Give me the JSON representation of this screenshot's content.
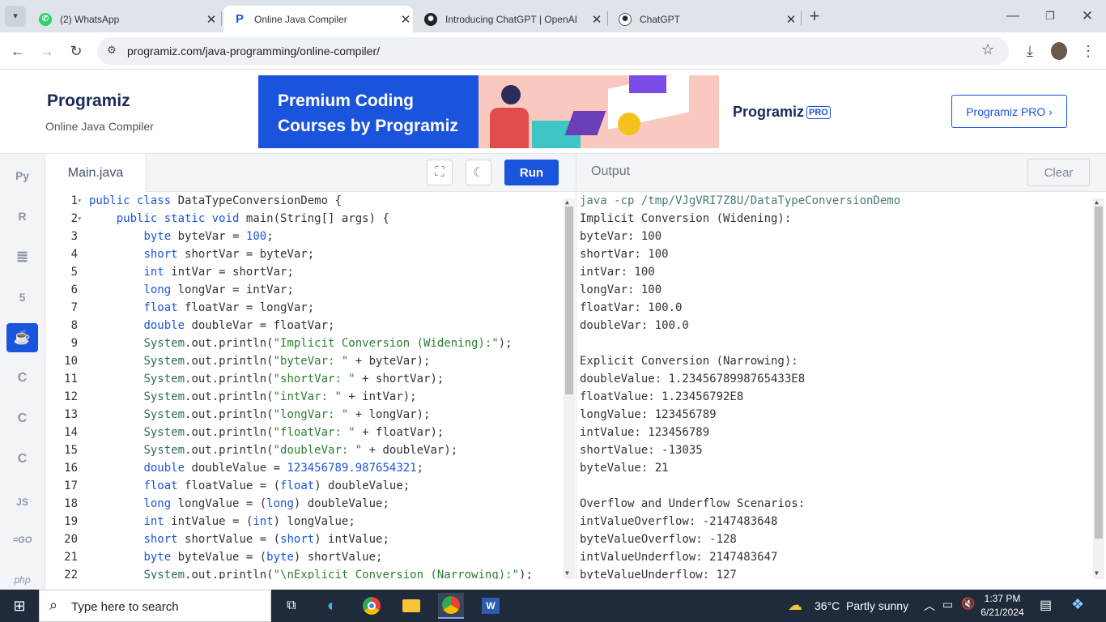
{
  "browser": {
    "tabs": [
      {
        "title": "(2) WhatsApp",
        "favicon": "whatsapp-icon"
      },
      {
        "title": "Online Java Compiler",
        "favicon": "programiz-icon",
        "active": true
      },
      {
        "title": "Introducing ChatGPT | OpenAI",
        "favicon": "openai-icon"
      },
      {
        "title": "ChatGPT",
        "favicon": "openai-icon"
      }
    ],
    "new_tab_symbol": "+",
    "url": "programiz.com/java-programming/online-compiler/"
  },
  "site": {
    "logo_text": "Programiz",
    "subtitle": "Online Java Compiler",
    "ad": {
      "headline_line1": "Premium Coding",
      "headline_line2": "Courses by Programiz",
      "brand": "Programiz",
      "brand_badge": "PRO"
    },
    "pro_button": "Programiz PRO ›"
  },
  "sidebar": {
    "items": [
      {
        "name": "python",
        "glyph": "Py"
      },
      {
        "name": "r",
        "glyph": "R"
      },
      {
        "name": "sql",
        "glyph": "≣"
      },
      {
        "name": "html",
        "glyph": "5"
      },
      {
        "name": "java",
        "glyph": "☕",
        "active": true
      },
      {
        "name": "c",
        "glyph": "C"
      },
      {
        "name": "cpp",
        "glyph": "C"
      },
      {
        "name": "csharp",
        "glyph": "C"
      },
      {
        "name": "js",
        "glyph": "JS"
      },
      {
        "name": "go",
        "glyph": "=GO"
      },
      {
        "name": "php",
        "glyph": "php"
      }
    ]
  },
  "editor": {
    "filename": "Main.java",
    "run_label": "Run",
    "lines": [
      {
        "n": "1",
        "fold": true,
        "tokens": [
          [
            "kw",
            "public class "
          ],
          [
            "t",
            "DataTypeConversionDemo {"
          ]
        ]
      },
      {
        "n": "2",
        "fold": true,
        "tokens": [
          [
            "t",
            "    "
          ],
          [
            "kw",
            "public static void "
          ],
          [
            "t",
            "main(String[] args) {"
          ]
        ]
      },
      {
        "n": "3",
        "tokens": [
          [
            "t",
            "        "
          ],
          [
            "kw",
            "byte "
          ],
          [
            "t",
            "byteVar = "
          ],
          [
            "num",
            "100"
          ],
          [
            "t",
            ";"
          ]
        ]
      },
      {
        "n": "4",
        "tokens": [
          [
            "t",
            "        "
          ],
          [
            "kw",
            "short "
          ],
          [
            "t",
            "shortVar = byteVar;"
          ]
        ]
      },
      {
        "n": "5",
        "tokens": [
          [
            "t",
            "        "
          ],
          [
            "kw",
            "int "
          ],
          [
            "t",
            "intVar = shortVar;"
          ]
        ]
      },
      {
        "n": "6",
        "tokens": [
          [
            "t",
            "        "
          ],
          [
            "kw",
            "long "
          ],
          [
            "t",
            "longVar = intVar;"
          ]
        ]
      },
      {
        "n": "7",
        "tokens": [
          [
            "t",
            "        "
          ],
          [
            "kw",
            "float "
          ],
          [
            "t",
            "floatVar = longVar;"
          ]
        ]
      },
      {
        "n": "8",
        "tokens": [
          [
            "t",
            "        "
          ],
          [
            "kw",
            "double "
          ],
          [
            "t",
            "doubleVar = floatVar;"
          ]
        ]
      },
      {
        "n": "9",
        "tokens": [
          [
            "t",
            "        "
          ],
          [
            "sys",
            "System"
          ],
          [
            "t",
            ".out.println("
          ],
          [
            "str",
            "\"Implicit Conversion (Widening):\""
          ],
          [
            "t",
            ");"
          ]
        ]
      },
      {
        "n": "10",
        "tokens": [
          [
            "t",
            "        "
          ],
          [
            "sys",
            "System"
          ],
          [
            "t",
            ".out.println("
          ],
          [
            "str",
            "\"byteVar: \""
          ],
          [
            "t",
            " + byteVar);"
          ]
        ]
      },
      {
        "n": "11",
        "tokens": [
          [
            "t",
            "        "
          ],
          [
            "sys",
            "System"
          ],
          [
            "t",
            ".out.println("
          ],
          [
            "str",
            "\"shortVar: \""
          ],
          [
            "t",
            " + shortVar);"
          ]
        ]
      },
      {
        "n": "12",
        "tokens": [
          [
            "t",
            "        "
          ],
          [
            "sys",
            "System"
          ],
          [
            "t",
            ".out.println("
          ],
          [
            "str",
            "\"intVar: \""
          ],
          [
            "t",
            " + intVar);"
          ]
        ]
      },
      {
        "n": "13",
        "tokens": [
          [
            "t",
            "        "
          ],
          [
            "sys",
            "System"
          ],
          [
            "t",
            ".out.println("
          ],
          [
            "str",
            "\"longVar: \""
          ],
          [
            "t",
            " + longVar);"
          ]
        ]
      },
      {
        "n": "14",
        "tokens": [
          [
            "t",
            "        "
          ],
          [
            "sys",
            "System"
          ],
          [
            "t",
            ".out.println("
          ],
          [
            "str",
            "\"floatVar: \""
          ],
          [
            "t",
            " + floatVar);"
          ]
        ]
      },
      {
        "n": "15",
        "tokens": [
          [
            "t",
            "        "
          ],
          [
            "sys",
            "System"
          ],
          [
            "t",
            ".out.println("
          ],
          [
            "str",
            "\"doubleVar: \""
          ],
          [
            "t",
            " + doubleVar);"
          ]
        ]
      },
      {
        "n": "16",
        "tokens": [
          [
            "t",
            "        "
          ],
          [
            "kw",
            "double "
          ],
          [
            "t",
            "doubleValue = "
          ],
          [
            "num",
            "123456789.987654321"
          ],
          [
            "t",
            ";"
          ]
        ]
      },
      {
        "n": "17",
        "tokens": [
          [
            "t",
            "        "
          ],
          [
            "kw",
            "float "
          ],
          [
            "t",
            "floatValue = ("
          ],
          [
            "kw",
            "float"
          ],
          [
            "t",
            ") doubleValue;"
          ]
        ]
      },
      {
        "n": "18",
        "tokens": [
          [
            "t",
            "        "
          ],
          [
            "kw",
            "long "
          ],
          [
            "t",
            "longValue = ("
          ],
          [
            "kw",
            "long"
          ],
          [
            "t",
            ") doubleValue;"
          ]
        ]
      },
      {
        "n": "19",
        "tokens": [
          [
            "t",
            "        "
          ],
          [
            "kw",
            "int "
          ],
          [
            "t",
            "intValue = ("
          ],
          [
            "kw",
            "int"
          ],
          [
            "t",
            ") longValue;"
          ]
        ]
      },
      {
        "n": "20",
        "tokens": [
          [
            "t",
            "        "
          ],
          [
            "kw",
            "short "
          ],
          [
            "t",
            "shortValue = ("
          ],
          [
            "kw",
            "short"
          ],
          [
            "t",
            ") intValue;"
          ]
        ]
      },
      {
        "n": "21",
        "tokens": [
          [
            "t",
            "        "
          ],
          [
            "kw",
            "byte "
          ],
          [
            "t",
            "byteValue = ("
          ],
          [
            "kw",
            "byte"
          ],
          [
            "t",
            ") shortValue;"
          ]
        ]
      },
      {
        "n": "22",
        "tokens": [
          [
            "t",
            "        "
          ],
          [
            "sys",
            "System"
          ],
          [
            "t",
            ".out.println("
          ],
          [
            "str",
            "\"\\nExplicit Conversion (Narrowing):\""
          ],
          [
            "t",
            ");"
          ]
        ]
      }
    ]
  },
  "output": {
    "title": "Output",
    "clear_label": "Clear",
    "command": "java -cp /tmp/VJgVRI7Z8U/DataTypeConversionDemo",
    "lines": [
      "Implicit Conversion (Widening):",
      "byteVar: 100",
      "shortVar: 100",
      "intVar: 100",
      "longVar: 100",
      "floatVar: 100.0",
      "doubleVar: 100.0",
      "",
      "Explicit Conversion (Narrowing):",
      "doubleValue: 1.2345678998765433E8",
      "floatValue: 1.23456792E8",
      "longValue: 123456789",
      "intValue: 123456789",
      "shortValue: -13035",
      "byteValue: 21",
      "",
      "Overflow and Underflow Scenarios:",
      "intValueOverflow: -2147483648",
      "byteValueOverflow: -128",
      "intValueUnderflow: 2147483647",
      "byteValueUnderflow: 127"
    ]
  },
  "taskbar": {
    "search_placeholder": "Type here to search",
    "weather": "36°C  Partly sunny",
    "time": "1:37 PM",
    "date": "6/21/2024"
  },
  "colors": {
    "accent": "#1b54dc",
    "command_text": "#4a7a75",
    "ad_bg": "#1b54dc"
  }
}
